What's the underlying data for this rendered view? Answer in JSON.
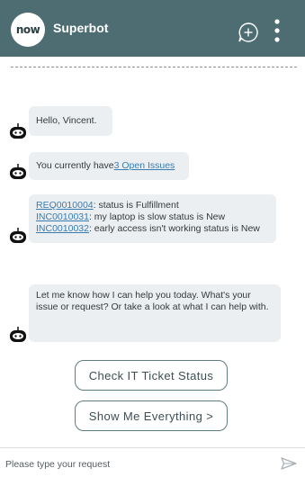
{
  "header": {
    "logo_text": "now",
    "title": "Superbot",
    "icons": {
      "new_chat": "chat-plus-icon",
      "more": "more-vertical-icon"
    }
  },
  "colors": {
    "header_bg": "#4d6d72",
    "bubble_bg": "#eceff1",
    "link": "#3a7cb0"
  },
  "messages": [
    {
      "text": "Hello, Vincent."
    },
    {
      "prefix": "You currently have ",
      "link": "3 Open Issues"
    },
    {
      "lines": [
        {
          "link": "REQ0010004",
          "text": ": status is Fulfillment"
        },
        {
          "link": "INC0010031",
          "text": ": my laptop is slow status is New"
        },
        {
          "link": "INC0010032",
          "text": ": early access isn't working status is New"
        }
      ]
    },
    {
      "text": "Let me know how I can help you today. What's your issue or request? Or take a look at what I can help with."
    }
  ],
  "choices": [
    {
      "label": "Check IT Ticket Status"
    },
    {
      "label": "Show Me Everything >"
    }
  ],
  "input": {
    "placeholder": "Please type your request",
    "value": ""
  },
  "send_icon": "send-icon",
  "avatar_icon": "bot-avatar-icon"
}
